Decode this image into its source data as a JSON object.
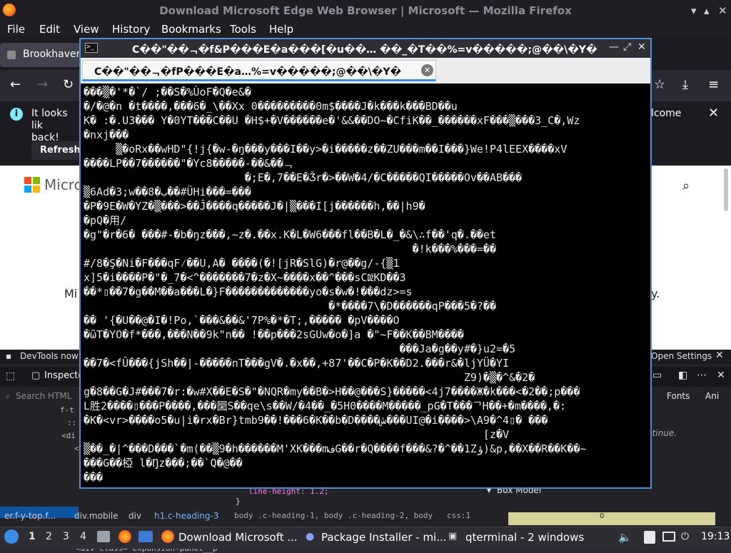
{
  "firefox": {
    "window_title": "Download Microsoft Edge Web Browser | Microsoft — Mozilla Firefox",
    "menu": [
      "File",
      "Edit",
      "View",
      "History",
      "Bookmarks",
      "Tools",
      "Help"
    ],
    "tab_title": "Brookhaven",
    "infobar": {
      "text": "It looks lik",
      "text2": "back!",
      "refresh_label": "Refresh",
      "welcome_fragment": "lcome"
    },
    "page": {
      "logo_text": "Microl",
      "fragment": "Mi",
      "fragment_right": "y."
    }
  },
  "devtools": {
    "notice_left": "DevTools now f",
    "notice_right": "Open Settings",
    "inspector_tab": "Inspecto",
    "search_placeholder": "Search HTML",
    "tree_lines": [
      "f-t",
      "::",
      "<di",
      "<",
      "",
      "",
      "",
      ""
    ],
    "tree_last": "<div class=\"expansion-panel__p",
    "breadcrumbs": [
      "er.f-y-top.f...",
      "div.mobile",
      "div",
      "h1.c-heading-3"
    ],
    "css_line_height": "line-height: 1.2;",
    "css_close": "}",
    "css_selectors": "body .c-heading-1, body .c-heading-2, body",
    "css_source": "css:1",
    "right_tabs": [
      "Fonts",
      "Ani"
    ],
    "continue": "ntinue.",
    "box_model": "Box Model",
    "box_zero": "0"
  },
  "qterminal": {
    "title": "C��\"��ᆨ�f&P���E�a���[�u��… ��_�T��%=v�����;@��\\�Y�",
    "tab_label": "C��\"��ᆨ�fP���E�a…%=v�����;@��\\�Y�",
    "lines": [
      "���▒�'*�`/ ;��S�%ÙoF�Q�e&�",
      "�/�@�n �t����,���6�_\\��Xx 0���������0m$����J�k���k���BD��u",
      "K� :�.U3��� Y�0YT���C��U �H$+�V������e�'&&��DO~�CfiK��_������xF���▒���3_C�,Wz",
      "�nxj���",
      "     ▒�oRx��wHD\"{!j{�w-�ŋ���y���I��y>�i�����z��ZU���m��I���}We!P4lEEX����xV",
      "����LP��7������\"�Yc8�����-��&��ᆨ",
      "                         �;E�,7��E�Ǯr�>��W�4/�C�����QI�����Ov��AB���",
      "▒6Ad�3;w��8�ب��#ÜHi���=���",
      "�P�9E�W�YZ�▒���>��Ĵ����q�����J�|▒���I[j������h,��|h9�",
      "�pQ�用/",
      "�g\"�r�6� ���#-�b�ŋz���,~z�.��x.K�L�W6���fl��B�L�_�&\\∴f��'q�.��et",
      "                                                   �!k���%���=��",
      "#/8�Ş�Ni�F���qF⁄��U,A� ����(�![jR�SlG)�r@��g/-{▒1",
      "x]5�i����P�\"�_7�<^�������7�z�X~����x��^���sCǅKD��3",
      "��*▯��7�g��M��a���L�}F�������������yo�s�w�!���dz>=s",
      "                                      �*����7\\�D������qP���5�?��",
      "�� '{�U��@�I�!Po,`���&��&'7P%�*�T;,����� �pV����O",
      "�ῶT�YO�f*���,���N��9k\"n�� !��p���2sGUw�o�]a �\"~F��K��BM����",
      "                                                 ���Ja�g��y#�}u2=�5",
      "��7�<fÛ���{jSh��|-�����nT���gV�.�x��,+87'��C�P�K��D2.���r&�ljYÜ�YI",
      "                                                           Z9)�▒�^&�2�",
      "g�8��G�J#���7�r:�w#X��E�S�\"�NQR�my��B�>H��@���S}�����<4j7����Ж�k���<�2��;p���",
      "L胜2����▯���P����,���圞S��qe\\s��W/�4��_�5H0����M�����_pG�T���ᄀH��+�m����,�:",
      "�K�<vr>����o5�u|i�rx�Br}tmb9��!���6�K��b�D����ش���UI@�i����>\\A9�^4▯� ���",
      "                                                              [z�V",
      "▒��_�|^���D���`�m(��▒9�h������M'XK���mفG��r�Q����f���&?�^��1Zؤ)&p,��X��R��K��~",
      "���G��椏 l�Ŋz���;��`Q�@��",
      "���"
    ]
  },
  "taskbar": {
    "workspaces": [
      "1",
      "2",
      "3",
      "4"
    ],
    "tasks": [
      "Download Microsoft ...",
      "Package Installer - mi...",
      "qterminal - 2 windows"
    ],
    "clock": "19:13"
  }
}
